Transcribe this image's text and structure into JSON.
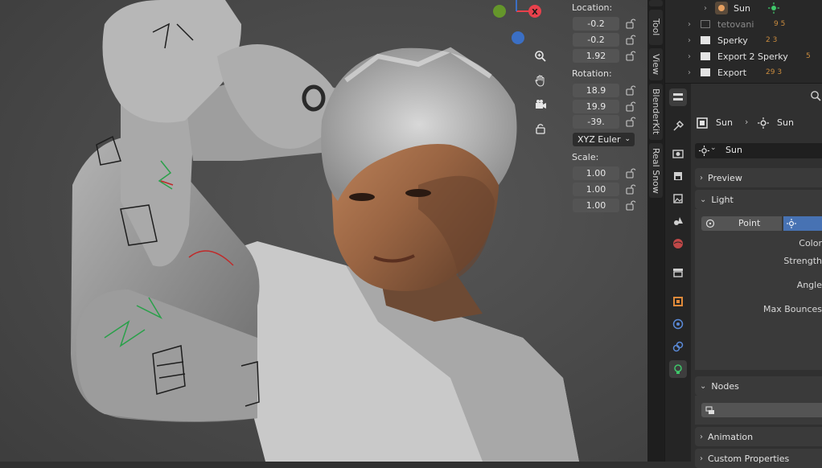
{
  "npanel": {
    "location_label": "Location:",
    "location": [
      "-0.2",
      "-0.2",
      "1.92"
    ],
    "rotation_label": "Rotation:",
    "rotation": [
      "18.9",
      "19.9",
      "-39."
    ],
    "rotation_mode": "XYZ Euler",
    "scale_label": "Scale:",
    "scale": [
      "1.00",
      "1.00",
      "1.00"
    ]
  },
  "gizmo": {
    "x_label": "X"
  },
  "side_tabs": [
    "Tool",
    "View",
    "BlenderKit",
    "Real Snow"
  ],
  "outliner": {
    "rows": [
      {
        "name": "Sun",
        "extra": ""
      },
      {
        "name": "tetovani",
        "extra": "9  5"
      },
      {
        "name": "Sperky",
        "extra": "2  3"
      },
      {
        "name": "Export 2 Sperky",
        "extra": "5"
      },
      {
        "name": "Export",
        "extra": "29  3"
      }
    ]
  },
  "properties": {
    "breadcrumb_object": "Sun",
    "breadcrumb_data": "Sun",
    "datablock_name": "Sun",
    "sections": {
      "preview": "Preview",
      "light": "Light",
      "nodes": "Nodes",
      "animation": "Animation",
      "custom_properties": "Custom Properties"
    },
    "light_types": [
      "Point",
      ""
    ],
    "light_props": [
      "Color",
      "Strength",
      "Angle",
      "Max Bounces"
    ]
  },
  "colors": {
    "accent": "#4772b3",
    "viewport_bg": "#4a4a4a",
    "panel_bg": "#303030",
    "axis_x": "#e8414c",
    "axis_y": "#6aa326",
    "axis_z": "#3b6fc4"
  }
}
